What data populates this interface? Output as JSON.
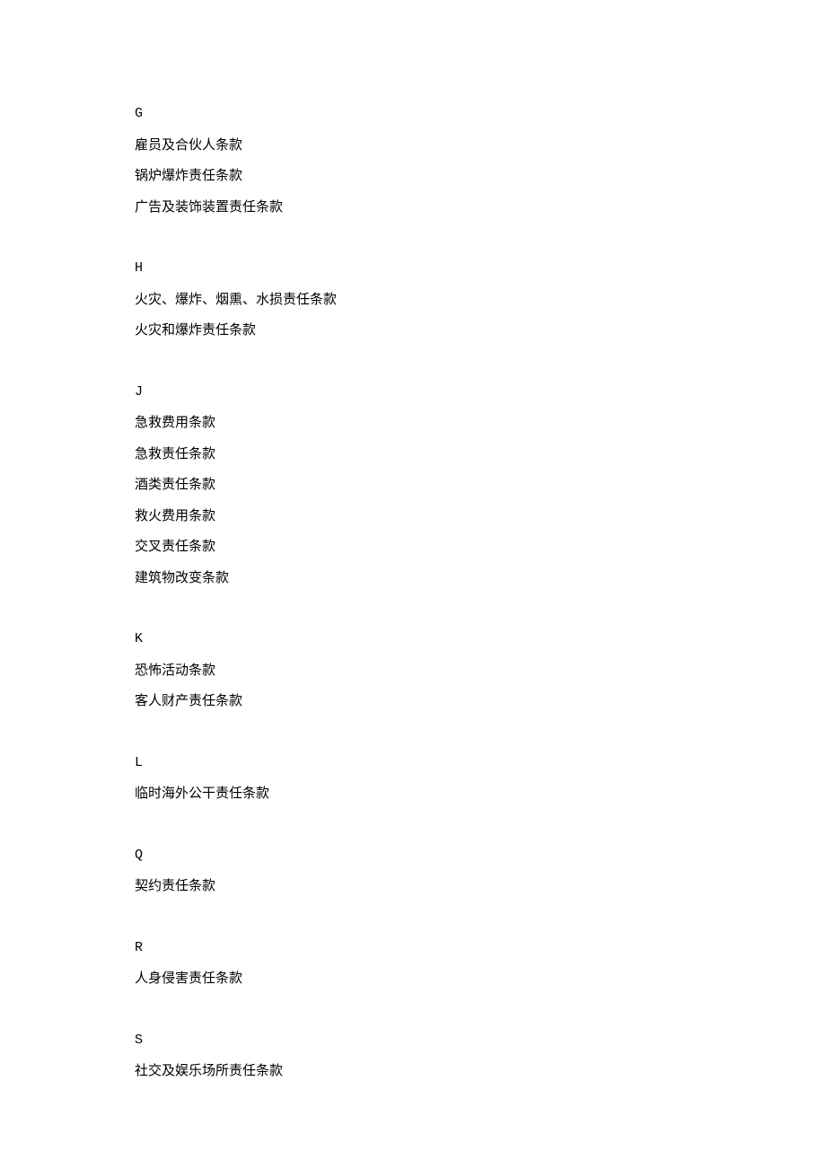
{
  "sections": [
    {
      "letter": "G",
      "items": [
        "雇员及合伙人条款",
        "锅炉爆炸责任条款",
        "广告及装饰装置责任条款"
      ]
    },
    {
      "letter": "H",
      "items": [
        "火灾、爆炸、烟熏、水损责任条款",
        "火灾和爆炸责任条款"
      ]
    },
    {
      "letter": "J",
      "items": [
        "急救费用条款",
        "急救责任条款",
        "酒类责任条款",
        "救火费用条款",
        "交叉责任条款",
        "建筑物改变条款"
      ]
    },
    {
      "letter": "K",
      "items": [
        "恐怖活动条款",
        "客人财产责任条款"
      ]
    },
    {
      "letter": "L",
      "items": [
        "临时海外公干责任条款"
      ]
    },
    {
      "letter": "Q",
      "items": [
        "契约责任条款"
      ]
    },
    {
      "letter": "R",
      "items": [
        "人身侵害责任条款"
      ]
    },
    {
      "letter": "S",
      "items": [
        "社交及娱乐场所责任条款"
      ]
    }
  ]
}
